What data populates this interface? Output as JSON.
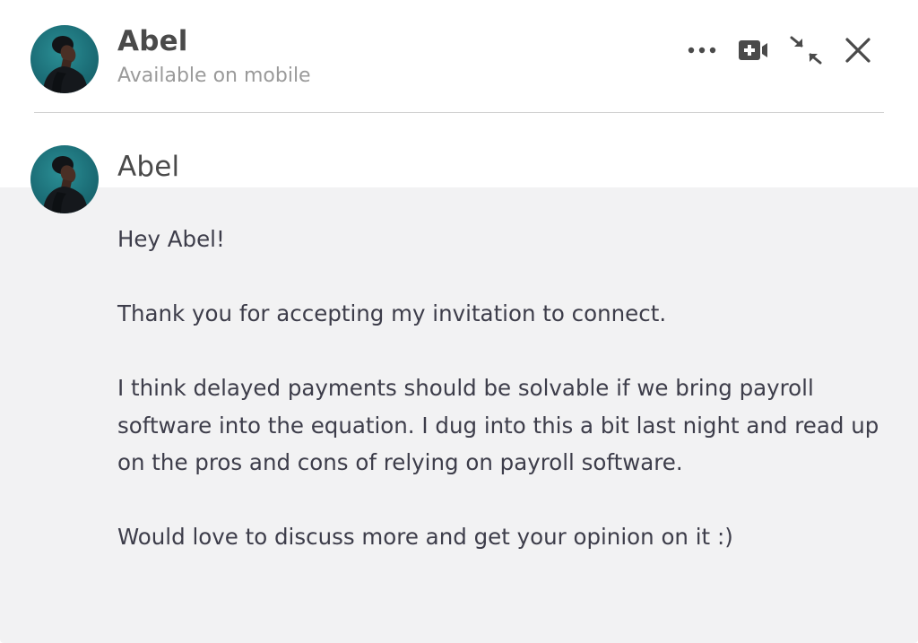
{
  "header": {
    "contact_name": "Abel",
    "status": "Available on mobile",
    "avatar_icon": "profile-photo",
    "actions": {
      "more": "more-options-icon",
      "video": "video-call-icon",
      "minimize": "minimize-icon",
      "close": "close-icon"
    }
  },
  "message": {
    "sender": "Abel",
    "paragraphs": [
      "Hey Abel!",
      "Thank you for accepting my invitation to connect.",
      "I think delayed payments should be solvable if we bring payroll software into the equation. I dug into this a bit last night and read up on the pros and cons of relying on payroll software.",
      "Would love to discuss more and get your opinion on it :)"
    ]
  },
  "colors": {
    "name_text": "#4a4a4a",
    "status_text": "#9a9a9a",
    "body_text": "#3d3d4a",
    "message_background": "#f2f2f3",
    "divider": "#cfcfcf",
    "avatar_background": "#1c6f78"
  }
}
